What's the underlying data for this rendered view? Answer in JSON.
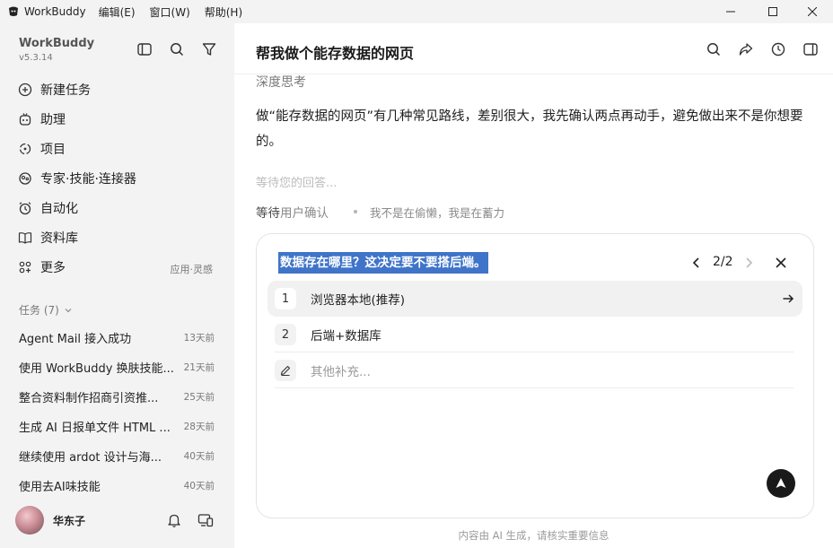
{
  "titlebar": {
    "app_name": "WorkBuddy",
    "menus": [
      "编辑(E)",
      "窗口(W)",
      "帮助(H)"
    ]
  },
  "sidebar": {
    "brand": "WorkBuddy",
    "version": "v5.3.14",
    "nav": [
      {
        "label": "新建任务",
        "icon": "new-task-icon"
      },
      {
        "label": "助理",
        "icon": "assistant-icon"
      },
      {
        "label": "项目",
        "icon": "project-icon"
      },
      {
        "label": "专家·技能·连接器",
        "icon": "experts-icon"
      },
      {
        "label": "自动化",
        "icon": "alarm-clock-icon"
      },
      {
        "label": "资料库",
        "icon": "book-icon"
      },
      {
        "label": "更多",
        "icon": "grid-icon"
      }
    ],
    "more_tag": "应用·灵感",
    "tasks_header": "任务 (7)",
    "tasks": [
      {
        "title": "Agent Mail 接入成功",
        "time": "13天前"
      },
      {
        "title": "使用 WorkBuddy 换肤技能...",
        "time": "21天前"
      },
      {
        "title": "整合资料制作招商引资推...",
        "time": "25天前"
      },
      {
        "title": "生成 AI 日报单文件 HTML ...",
        "time": "28天前"
      },
      {
        "title": "继续使用 ardot 设计与海...",
        "time": "40天前"
      },
      {
        "title": "使用去AI味技能",
        "time": "40天前"
      }
    ],
    "user_name": "华东子"
  },
  "main": {
    "chat_title": "帮我做个能存数据的网页",
    "thinking_label": "深度思考",
    "answer": "做“能存数据的网页”有几种常见路线，差别很大，我先确认两点再动手，避免做出来不是你想要的。",
    "waiting": "等待您的回答...",
    "status_strong": "等待",
    "status_rest": "用户确认",
    "status_sub": "我不是在偷懒，我是在蓄力",
    "question": {
      "title": "数据存在哪里？这决定要不要搭后端。",
      "pager": "2/2",
      "options": [
        {
          "num": "1",
          "label": "浏览器本地(推荐)"
        },
        {
          "num": "2",
          "label": "后端+数据库"
        }
      ],
      "other_placeholder": "其他补充..."
    },
    "footer_note": "内容由 AI 生成，请核实重要信息"
  },
  "colors": {
    "sidebar_bg": "#f3f3f4",
    "selection_highlight": "#3f74c9",
    "send_button": "#1a1a1a"
  }
}
